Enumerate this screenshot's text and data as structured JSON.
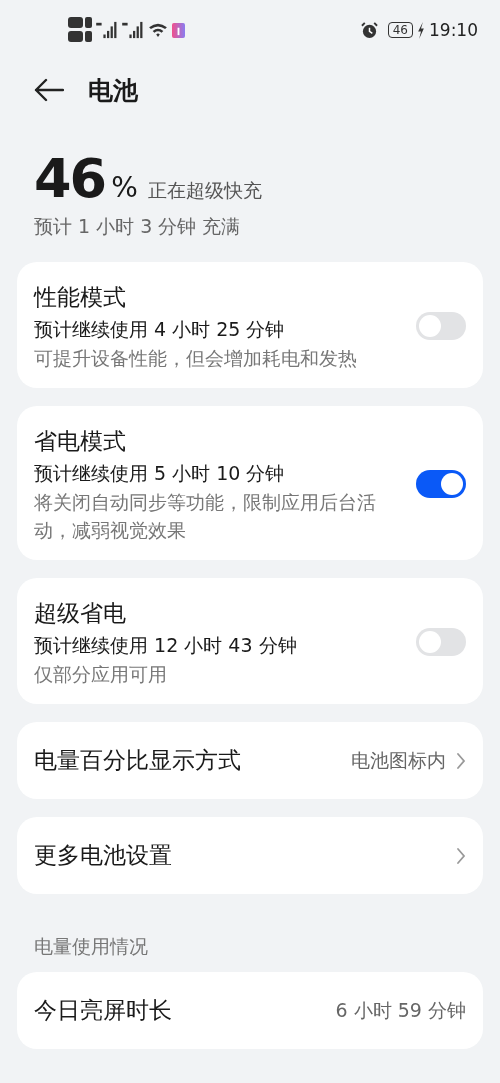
{
  "status_bar": {
    "battery": "46",
    "time": "19:10"
  },
  "header": {
    "title": "电池"
  },
  "summary": {
    "percent": "46",
    "unit": "%",
    "state": "正在超级快充",
    "estimate": "预计 1 小时 3 分钟 充满"
  },
  "cards": [
    {
      "kind": "toggle",
      "title": "性能模式",
      "subtitle": "预计继续使用 4 小时 25 分钟",
      "description": "可提升设备性能，但会增加耗电和发热",
      "on": false
    },
    {
      "kind": "toggle",
      "title": "省电模式",
      "subtitle": "预计继续使用 5 小时 10 分钟",
      "description": "将关闭自动同步等功能，限制应用后台活动，减弱视觉效果",
      "on": true
    },
    {
      "kind": "toggle",
      "title": "超级省电",
      "subtitle": "预计继续使用 12 小时 43 分钟",
      "description": "仅部分应用可用",
      "on": false
    },
    {
      "kind": "link",
      "title": "电量百分比显示方式",
      "value": "电池图标内"
    },
    {
      "kind": "link",
      "title": "更多电池设置"
    }
  ],
  "usage": {
    "heading": "电量使用情况",
    "rows": [
      {
        "label": "今日亮屏时长",
        "value": "6 小时 59 分钟"
      }
    ]
  }
}
